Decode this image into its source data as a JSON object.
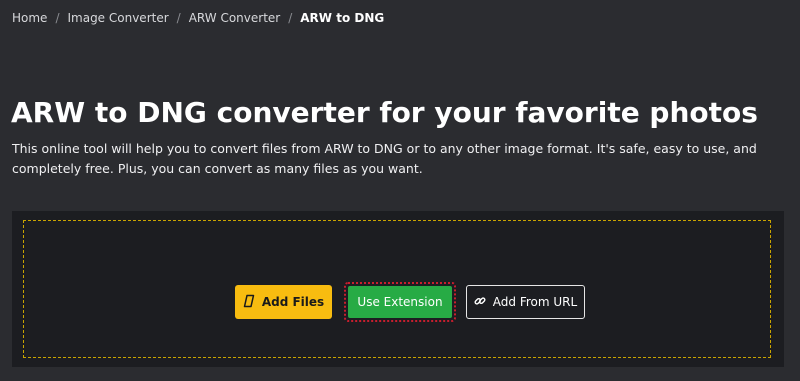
{
  "breadcrumb": {
    "items": [
      "Home",
      "Image Converter",
      "ARW Converter"
    ],
    "separator": "/",
    "current": "ARW to DNG"
  },
  "hero": {
    "title": "ARW to DNG converter for your favorite photos",
    "description": "This online tool will help you to convert files from ARW to DNG or to any other image format. It's safe, easy to use, and completely free. Plus, you can convert as many files as you want."
  },
  "upload": {
    "add_files_label": "Add Files",
    "use_extension_label": "Use Extension",
    "add_from_url_label": "Add From URL",
    "icons": {
      "add_files": "file-icon",
      "add_from_url": "link-icon"
    }
  },
  "colors": {
    "page_background": "#2b2c30",
    "panel_background": "#1c1d21",
    "drop_zone_border": "#c9a400",
    "add_files_button": "#f8bc10",
    "use_extension_button": "#27ab45",
    "focus_outline": "#c81e2e"
  }
}
